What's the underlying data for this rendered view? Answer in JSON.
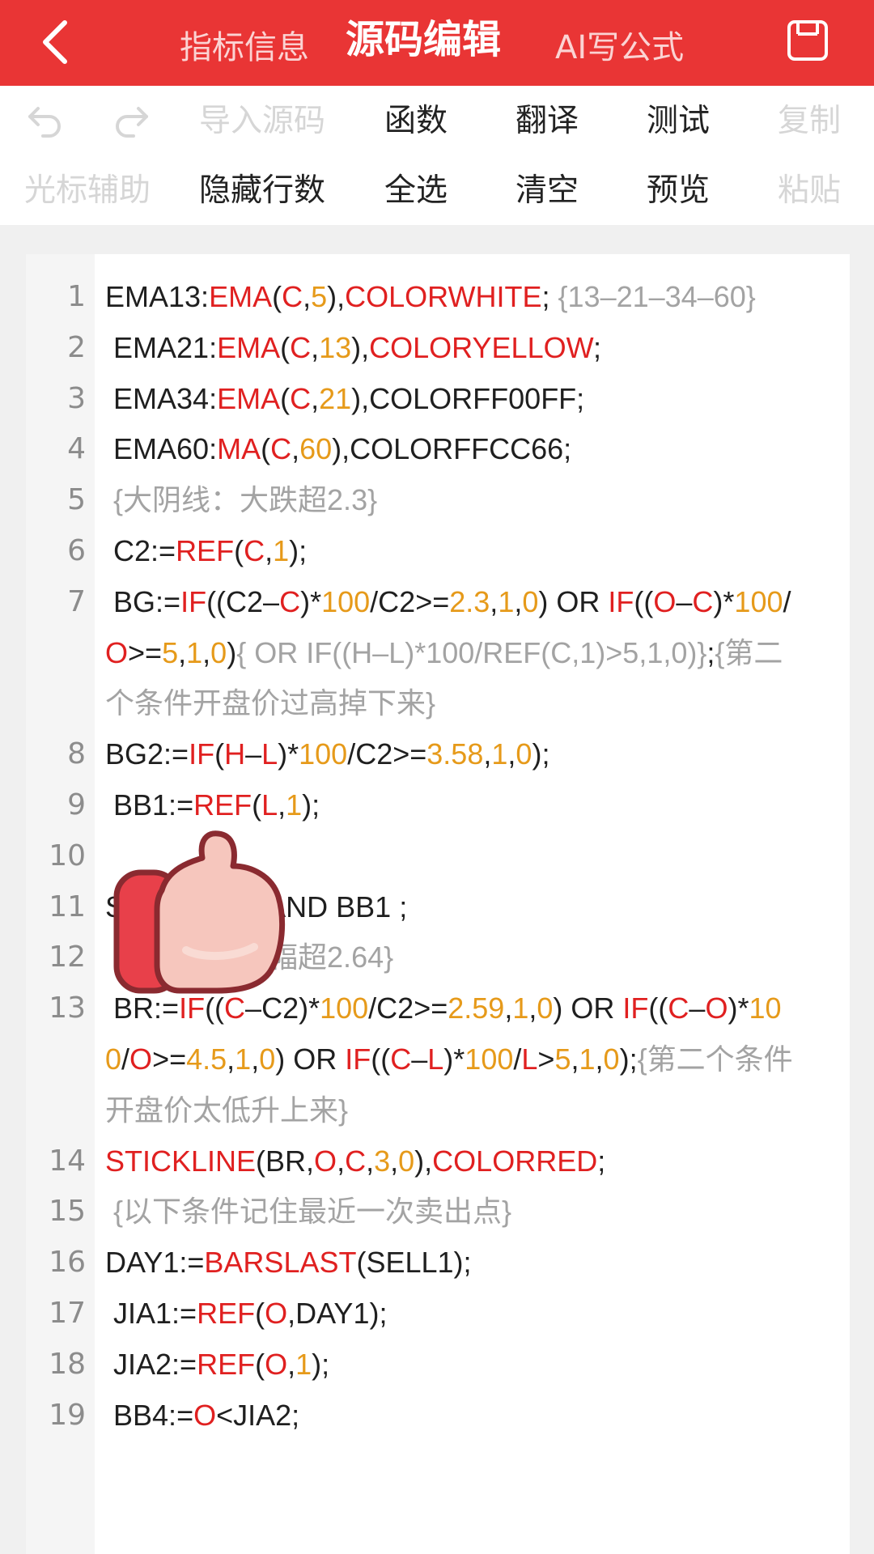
{
  "header": {
    "tabs": [
      {
        "label": "指标信息"
      },
      {
        "label": "源码编辑"
      },
      {
        "label": "AI写公式"
      }
    ]
  },
  "toolbar": {
    "row1": {
      "import_label": "导入源码",
      "function_label": "函数",
      "translate_label": "翻译",
      "test_label": "测试",
      "copy_label": "复制"
    },
    "row2": {
      "cursor_label": "光标辅助",
      "hide_lines_label": "隐藏行数",
      "select_all_label": "全选",
      "clear_label": "清空",
      "preview_label": "预览",
      "paste_label": "粘贴"
    }
  },
  "editor": {
    "line_numbers": [
      "1",
      "2",
      "3",
      "4",
      "5",
      "6",
      "7",
      "8",
      "9",
      "10",
      "11",
      "12",
      "13",
      "14",
      "15",
      "16",
      "17",
      "18",
      "19"
    ],
    "lines": [
      [
        [
          "k",
          "EMA13:"
        ],
        [
          "fn",
          "EMA"
        ],
        [
          "k",
          "("
        ],
        [
          "fn",
          "C"
        ],
        [
          "k",
          ","
        ],
        [
          "nm",
          "5"
        ],
        [
          "k",
          "),"
        ],
        [
          "fn",
          "COLORWHITE"
        ],
        [
          "k",
          "; "
        ],
        [
          "cm",
          "{13–21–34–60}"
        ]
      ],
      [
        [
          "k",
          " EMA21:"
        ],
        [
          "fn",
          "EMA"
        ],
        [
          "k",
          "("
        ],
        [
          "fn",
          "C"
        ],
        [
          "k",
          ","
        ],
        [
          "nm",
          "13"
        ],
        [
          "k",
          "),"
        ],
        [
          "fn",
          "COLORYELLOW"
        ],
        [
          "k",
          ";"
        ]
      ],
      [
        [
          "k",
          " EMA34:"
        ],
        [
          "fn",
          "EMA"
        ],
        [
          "k",
          "("
        ],
        [
          "fn",
          "C"
        ],
        [
          "k",
          ","
        ],
        [
          "nm",
          "21"
        ],
        [
          "k",
          "),COLORFF00FF;"
        ]
      ],
      [
        [
          "k",
          " EMA60:"
        ],
        [
          "fn",
          "MA"
        ],
        [
          "k",
          "("
        ],
        [
          "fn",
          "C"
        ],
        [
          "k",
          ","
        ],
        [
          "nm",
          "60"
        ],
        [
          "k",
          "),COLORFFCC66;"
        ]
      ],
      [
        [
          "cm",
          " {大阴线：大跌超2.3}"
        ]
      ],
      [
        [
          "k",
          " C2:="
        ],
        [
          "fn",
          "REF"
        ],
        [
          "k",
          "("
        ],
        [
          "fn",
          "C"
        ],
        [
          "k",
          ","
        ],
        [
          "nm",
          "1"
        ],
        [
          "k",
          ");"
        ]
      ],
      [
        [
          "k",
          " BG:="
        ],
        [
          "fn",
          "IF"
        ],
        [
          "k",
          "((C2–"
        ],
        [
          "fn",
          "C"
        ],
        [
          "k",
          ")*"
        ],
        [
          "nm",
          "100"
        ],
        [
          "k",
          "/C2>="
        ],
        [
          "nm",
          "2.3"
        ],
        [
          "k",
          ","
        ],
        [
          "nm",
          "1"
        ],
        [
          "k",
          ","
        ],
        [
          "nm",
          "0"
        ],
        [
          "k",
          ") OR "
        ],
        [
          "fn",
          "IF"
        ],
        [
          "k",
          "(("
        ],
        [
          "fn",
          "O"
        ],
        [
          "k",
          "–"
        ],
        [
          "fn",
          "C"
        ],
        [
          "k",
          ")*"
        ],
        [
          "nm",
          "100"
        ],
        [
          "k",
          "/"
        ],
        [
          "fn",
          "O"
        ],
        [
          "k",
          ">="
        ],
        [
          "nm",
          "5"
        ],
        [
          "k",
          ","
        ],
        [
          "nm",
          "1"
        ],
        [
          "k",
          ","
        ],
        [
          "nm",
          "0"
        ],
        [
          "k",
          ")"
        ],
        [
          "cm",
          "{ OR IF((H–L)*100/REF(C,1)>5,1,0)}"
        ],
        [
          "k",
          ";"
        ],
        [
          "cm",
          "{第二个条件开盘价过高掉下来}"
        ]
      ],
      [
        [
          "k",
          "BG2:="
        ],
        [
          "fn",
          "IF"
        ],
        [
          "k",
          "("
        ],
        [
          "fn",
          "H"
        ],
        [
          "k",
          "–"
        ],
        [
          "fn",
          "L"
        ],
        [
          "k",
          ")*"
        ],
        [
          "nm",
          "100"
        ],
        [
          "k",
          "/C2>="
        ],
        [
          "nm",
          "3.58"
        ],
        [
          "k",
          ","
        ],
        [
          "nm",
          "1"
        ],
        [
          "k",
          ","
        ],
        [
          "nm",
          "0"
        ],
        [
          "k",
          ");"
        ]
      ],
      [
        [
          "k",
          " BB1:="
        ],
        [
          "fn",
          "REF"
        ],
        [
          "k",
          "("
        ],
        [
          "fn",
          "L"
        ],
        [
          "k",
          ","
        ],
        [
          "nm",
          "1"
        ],
        [
          "k",
          ");"
        ]
      ],
      [
        [
          "k",
          " "
        ]
      ],
      [
        [
          "k",
          "SELL1:=BG AND BB1 ;"
        ]
      ],
      [
        [
          "cm",
          " {大阳线：升幅超2.64}"
        ]
      ],
      [
        [
          "k",
          " BR:="
        ],
        [
          "fn",
          "IF"
        ],
        [
          "k",
          "(("
        ],
        [
          "fn",
          "C"
        ],
        [
          "k",
          "–C2)*"
        ],
        [
          "nm",
          "100"
        ],
        [
          "k",
          "/C2>="
        ],
        [
          "nm",
          "2.59"
        ],
        [
          "k",
          ","
        ],
        [
          "nm",
          "1"
        ],
        [
          "k",
          ","
        ],
        [
          "nm",
          "0"
        ],
        [
          "k",
          ") OR "
        ],
        [
          "fn",
          "IF"
        ],
        [
          "k",
          "(("
        ],
        [
          "fn",
          "C"
        ],
        [
          "k",
          "–"
        ],
        [
          "fn",
          "O"
        ],
        [
          "k",
          ")*"
        ],
        [
          "nm",
          "100"
        ],
        [
          "k",
          "/"
        ],
        [
          "fn",
          "O"
        ],
        [
          "k",
          ">="
        ],
        [
          "nm",
          "4.5"
        ],
        [
          "k",
          ","
        ],
        [
          "nm",
          "1"
        ],
        [
          "k",
          ","
        ],
        [
          "nm",
          "0"
        ],
        [
          "k",
          ") OR "
        ],
        [
          "fn",
          "IF"
        ],
        [
          "k",
          "(("
        ],
        [
          "fn",
          "C"
        ],
        [
          "k",
          "–"
        ],
        [
          "fn",
          "L"
        ],
        [
          "k",
          ")*"
        ],
        [
          "nm",
          "100"
        ],
        [
          "k",
          "/"
        ],
        [
          "fn",
          "L"
        ],
        [
          "k",
          ">"
        ],
        [
          "nm",
          "5"
        ],
        [
          "k",
          ","
        ],
        [
          "nm",
          "1"
        ],
        [
          "k",
          ","
        ],
        [
          "nm",
          "0"
        ],
        [
          "k",
          ");"
        ],
        [
          "cm",
          "{第二个条件开盘价太低升上来}"
        ]
      ],
      [
        [
          "fn",
          "STICKLINE"
        ],
        [
          "k",
          "(BR,"
        ],
        [
          "fn",
          "O"
        ],
        [
          "k",
          ","
        ],
        [
          "fn",
          "C"
        ],
        [
          "k",
          ","
        ],
        [
          "nm",
          "3"
        ],
        [
          "k",
          ","
        ],
        [
          "nm",
          "0"
        ],
        [
          "k",
          "),"
        ],
        [
          "fn",
          "COLORRED"
        ],
        [
          "k",
          ";"
        ]
      ],
      [
        [
          "cm",
          " {以下条件记住最近一次卖出点}"
        ]
      ],
      [
        [
          "k",
          "DAY1:="
        ],
        [
          "fn",
          "BARSLAST"
        ],
        [
          "k",
          "(SELL1);"
        ]
      ],
      [
        [
          "k",
          " JIA1:="
        ],
        [
          "fn",
          "REF"
        ],
        [
          "k",
          "("
        ],
        [
          "fn",
          "O"
        ],
        [
          "k",
          ",DAY1);"
        ]
      ],
      [
        [
          "k",
          " JIA2:="
        ],
        [
          "fn",
          "REF"
        ],
        [
          "k",
          "("
        ],
        [
          "fn",
          "O"
        ],
        [
          "k",
          ","
        ],
        [
          "nm",
          "1"
        ],
        [
          "k",
          ");"
        ]
      ],
      [
        [
          "k",
          " BB4:="
        ],
        [
          "fn",
          "O"
        ],
        [
          "k",
          "<JIA2;"
        ]
      ]
    ]
  },
  "colors": {
    "header_red": "#e93535",
    "function_red": "#e02020",
    "number_orange": "#e69a1a",
    "comment_gray": "#a3a3a3"
  },
  "icons": {
    "back": "chevron-left-icon",
    "save": "save-icon",
    "undo": "undo-icon",
    "redo": "redo-icon",
    "overlay": "thumbs-up-icon"
  }
}
